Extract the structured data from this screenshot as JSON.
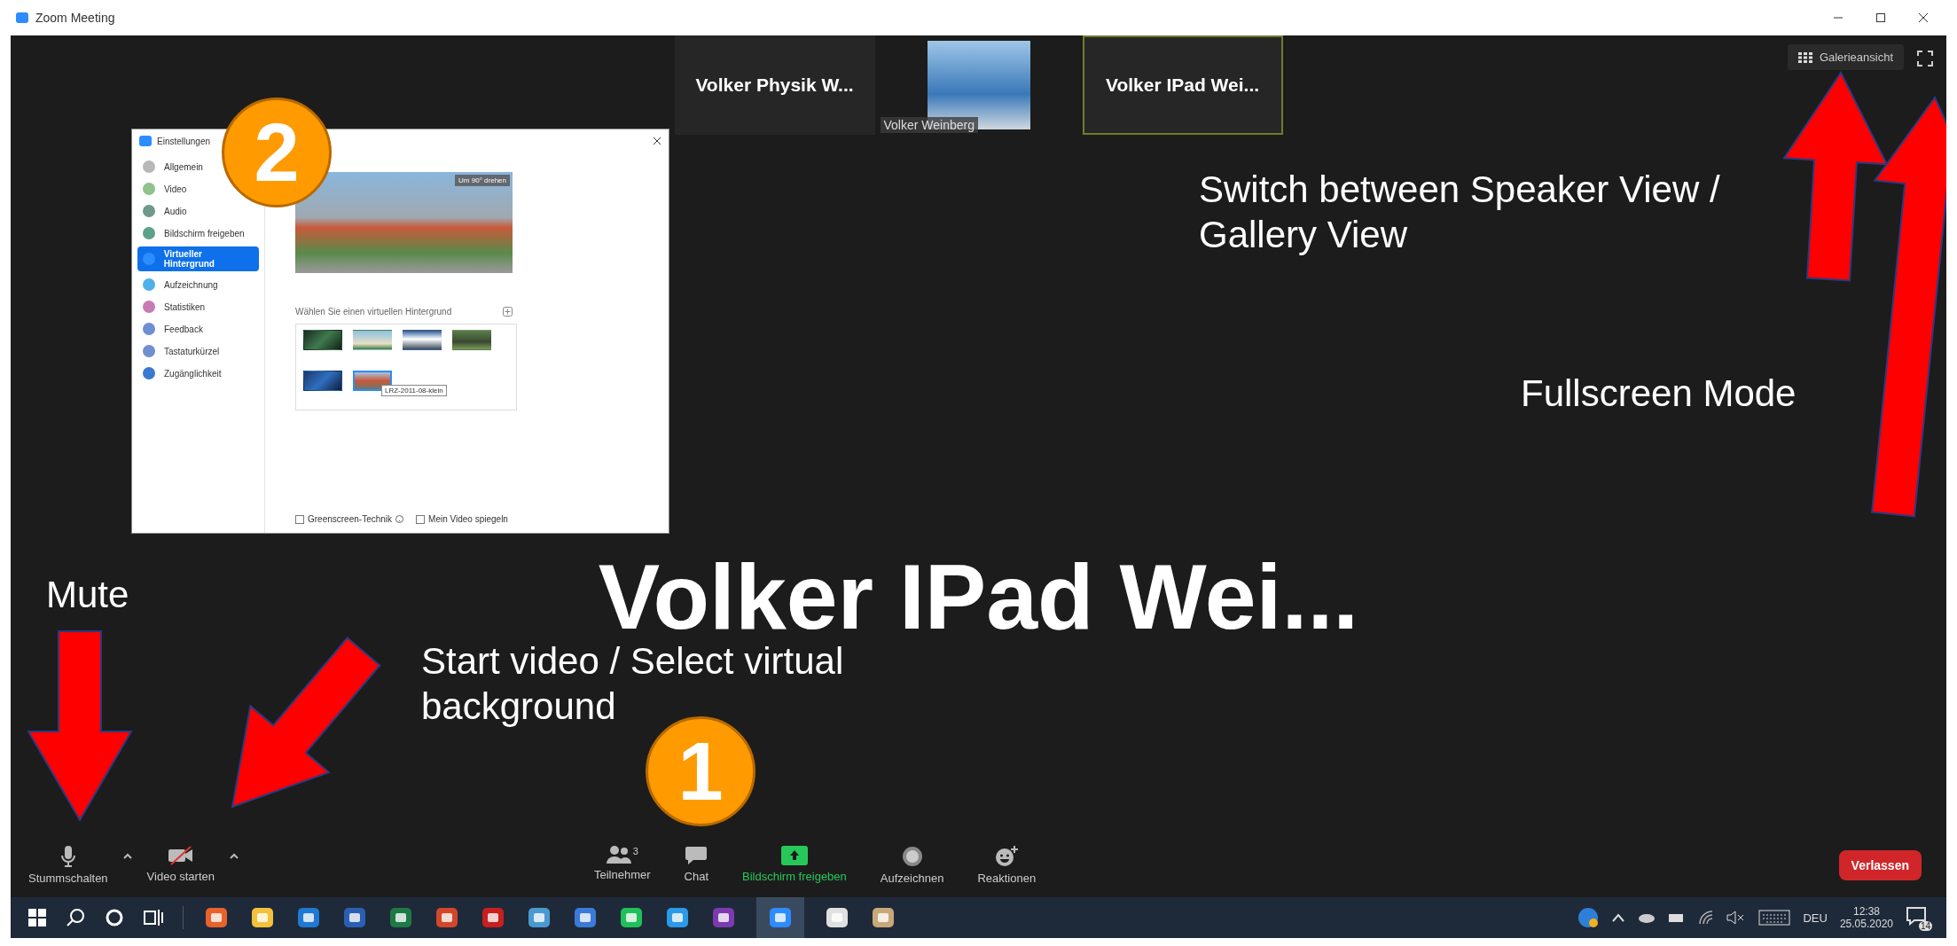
{
  "window": {
    "title": "Zoom Meeting"
  },
  "thumbnails": [
    {
      "kind": "name",
      "name": "Volker Physik W...",
      "selected": false
    },
    {
      "kind": "video",
      "name": "Volker Weinberg",
      "selected": false
    },
    {
      "kind": "name",
      "name": "Volker IPad Wei...",
      "selected": true
    }
  ],
  "view_button": {
    "label": "Galerieansicht"
  },
  "speaker": {
    "name": "Volker IPad Wei..."
  },
  "settings": {
    "title": "Einstellungen",
    "nav": [
      {
        "label": "Allgemein",
        "color": "#b8b8b8",
        "selected": false
      },
      {
        "label": "Video",
        "color": "#8fc28c",
        "selected": false
      },
      {
        "label": "Audio",
        "color": "#6f9a8a",
        "selected": false
      },
      {
        "label": "Bildschirm freigeben",
        "color": "#5aa28a",
        "selected": false
      },
      {
        "label": "Virtueller Hintergrund",
        "color": "#2d8cff",
        "selected": true
      },
      {
        "label": "Aufzeichnung",
        "color": "#4fb0e8",
        "selected": false
      },
      {
        "label": "Statistiken",
        "color": "#c77bb5",
        "selected": false
      },
      {
        "label": "Feedback",
        "color": "#6f8fd0",
        "selected": false
      },
      {
        "label": "Tastaturkürzel",
        "color": "#6f8fd0",
        "selected": false
      },
      {
        "label": "Zugänglichkeit",
        "color": "#3a7ad0",
        "selected": false
      }
    ],
    "rotate_button": "Um 90° drehen",
    "background_heading": "Wählen Sie einen virtuellen Hintergrund",
    "backgrounds": [
      {
        "selected": false
      },
      {
        "selected": false
      },
      {
        "selected": false
      },
      {
        "selected": false
      },
      {
        "selected": false
      },
      {
        "selected": true
      }
    ],
    "tooltip": "LRZ-2011-08-klein",
    "options": [
      {
        "label": "Greenscreen-Technik",
        "checked": false,
        "help": true
      },
      {
        "label": "Mein Video spiegeln",
        "checked": false,
        "help": false
      }
    ]
  },
  "toolbar": {
    "left": [
      {
        "kind": "mic",
        "label": "Stummschalten"
      },
      {
        "kind": "video",
        "label": "Video starten"
      }
    ],
    "center": [
      {
        "kind": "participants",
        "label": "Teilnehmer",
        "count": "3"
      },
      {
        "kind": "chat",
        "label": "Chat"
      },
      {
        "kind": "share",
        "label": "Bildschirm freigeben"
      },
      {
        "kind": "record",
        "label": "Aufzeichnen"
      },
      {
        "kind": "reactions",
        "label": "Reaktionen"
      }
    ],
    "leave_button": "Verlassen"
  },
  "taskbar": {
    "apps": [
      {
        "kind": "browser",
        "selected": false
      },
      {
        "kind": "folder",
        "selected": false
      },
      {
        "kind": "mail",
        "selected": false
      },
      {
        "kind": "word",
        "selected": false
      },
      {
        "kind": "sheet",
        "selected": false
      },
      {
        "kind": "slides",
        "selected": false
      },
      {
        "kind": "pdf",
        "selected": false
      },
      {
        "kind": "globe",
        "selected": false
      },
      {
        "kind": "network",
        "selected": false
      },
      {
        "kind": "ring",
        "selected": false
      },
      {
        "kind": "bolt",
        "selected": false
      },
      {
        "kind": "note",
        "selected": false
      },
      {
        "kind": "camera",
        "selected": true
      },
      {
        "kind": "cloud",
        "selected": false
      },
      {
        "kind": "palette",
        "selected": false
      }
    ],
    "language": "DEU",
    "time": "12:38",
    "date": "25.05.2020",
    "notifications": "14"
  },
  "annotations": [
    {
      "text": "Switch between Speaker View / Gallery View"
    },
    {
      "text": "Fullscreen Mode"
    },
    {
      "text": "Mute"
    },
    {
      "text": "Start video / Select virtual background"
    }
  ],
  "markers": [
    {
      "number": "1"
    },
    {
      "number": "2"
    }
  ]
}
